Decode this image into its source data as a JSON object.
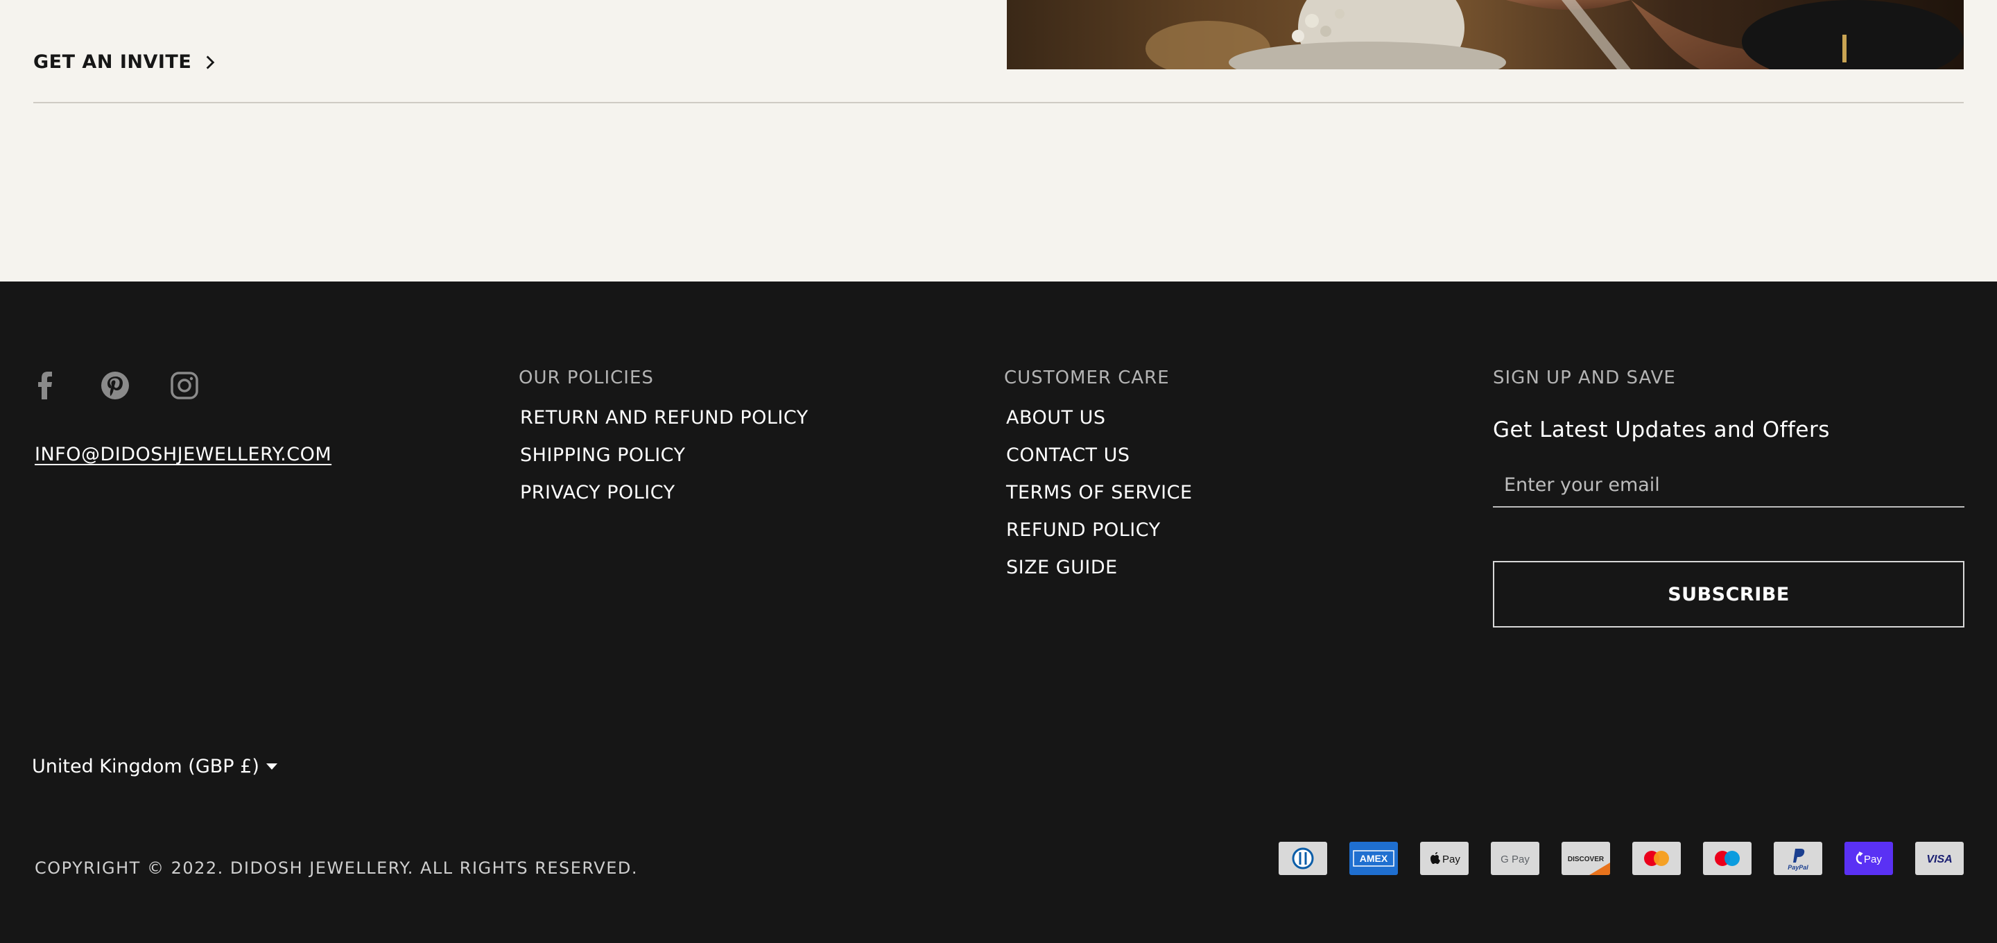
{
  "top": {
    "invite_label": "GET AN INVITE"
  },
  "footer": {
    "social": [
      {
        "icon": "facebook-icon"
      },
      {
        "icon": "pinterest-icon"
      },
      {
        "icon": "instagram-icon"
      }
    ],
    "email": "INFO@DIDOSHJEWELLERY.COM",
    "policies": {
      "title": "OUR POLICIES",
      "items": [
        "RETURN AND REFUND POLICY",
        "SHIPPING POLICY",
        "PRIVACY POLICY"
      ]
    },
    "customer_care": {
      "title": "CUSTOMER CARE",
      "items": [
        "ABOUT US",
        "CONTACT US",
        "TERMS OF SERVICE",
        "REFUND POLICY",
        "SIZE GUIDE"
      ]
    },
    "signup": {
      "title": "SIGN UP AND SAVE",
      "tagline": "Get Latest Updates and Offers",
      "email_placeholder": "Enter your email",
      "button_label": "SUBSCRIBE"
    },
    "currency": "United Kingdom (GBP £)",
    "copyright": "COPYRIGHT © 2022. DIDOSH JEWELLERY. ALL RIGHTS RESERVED.",
    "payments": [
      {
        "icon": "diners-club-icon",
        "label": ""
      },
      {
        "icon": "amex-icon",
        "label": "AMEX"
      },
      {
        "icon": "apple-pay-icon",
        "label": "Pay"
      },
      {
        "icon": "google-pay-icon",
        "label": "G Pay"
      },
      {
        "icon": "discover-icon",
        "label": "DISCOVER"
      },
      {
        "icon": "mastercard-icon",
        "label": ""
      },
      {
        "icon": "maestro-icon",
        "label": ""
      },
      {
        "icon": "paypal-icon",
        "label": "PayPal"
      },
      {
        "icon": "shop-pay-icon",
        "label": "Pay"
      },
      {
        "icon": "visa-icon",
        "label": "VISA"
      }
    ]
  },
  "colors": {
    "page_bg": "#f5f3ee",
    "footer_bg": "#161616",
    "footer_title": "#b4b4b4",
    "text_light": "#ffffff"
  }
}
